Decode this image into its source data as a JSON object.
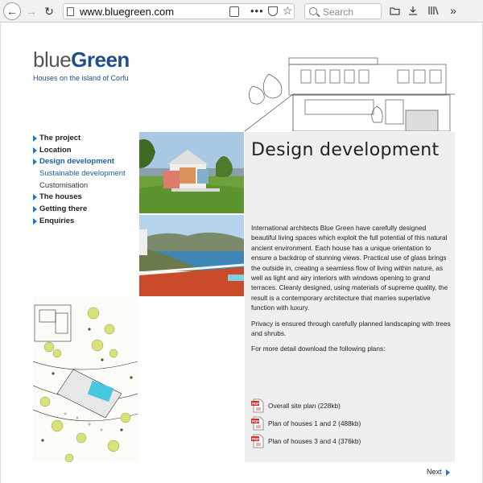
{
  "browser": {
    "url": "www.bluegreen.com",
    "search_placeholder": "Search",
    "menu_dots": "•••"
  },
  "logo": {
    "part1": "blue",
    "part2": "Green",
    "tagline": "Houses on the island of Corfu"
  },
  "nav": {
    "items": [
      {
        "label": "The project"
      },
      {
        "label": "Location"
      },
      {
        "label": "Design development"
      },
      {
        "label": "Sustainable development"
      },
      {
        "label": "Customisation"
      },
      {
        "label": "The houses"
      },
      {
        "label": "Getting there"
      },
      {
        "label": "Enquiries"
      }
    ]
  },
  "content": {
    "title": "Design development",
    "paragraphs": [
      "International architects Blue Green have carefully designed beautiful living spaces which exploit the full potential of this natural ancient environment. Each house has a unique orientation to ensure a backdrop of stunning views. Practical use of glass brings the outside in, creating a seamless flow of living within nature, as well as light and airy interiors with windows opening to grand terraces. Cleanly designed, using materials of supreme quality, the result is a contemporary architecture that marries superlative function with luxury.",
      "Privacy is ensured through carefully planned landscaping with trees and shrubs.",
      "For more detail download the following plans:"
    ],
    "plans": [
      {
        "label": "Overall site plan (228kb)"
      },
      {
        "label": "Plan of houses 1 and 2 (488kb)"
      },
      {
        "label": "Plan of houses 3 and 4 (376kb)"
      }
    ],
    "pdf_badge": "PDF"
  },
  "footer": {
    "next_label": "Next"
  },
  "colors": {
    "accent": "#1a7ac9",
    "active_link": "#1a5fa8",
    "content_bg": "#efefef"
  }
}
